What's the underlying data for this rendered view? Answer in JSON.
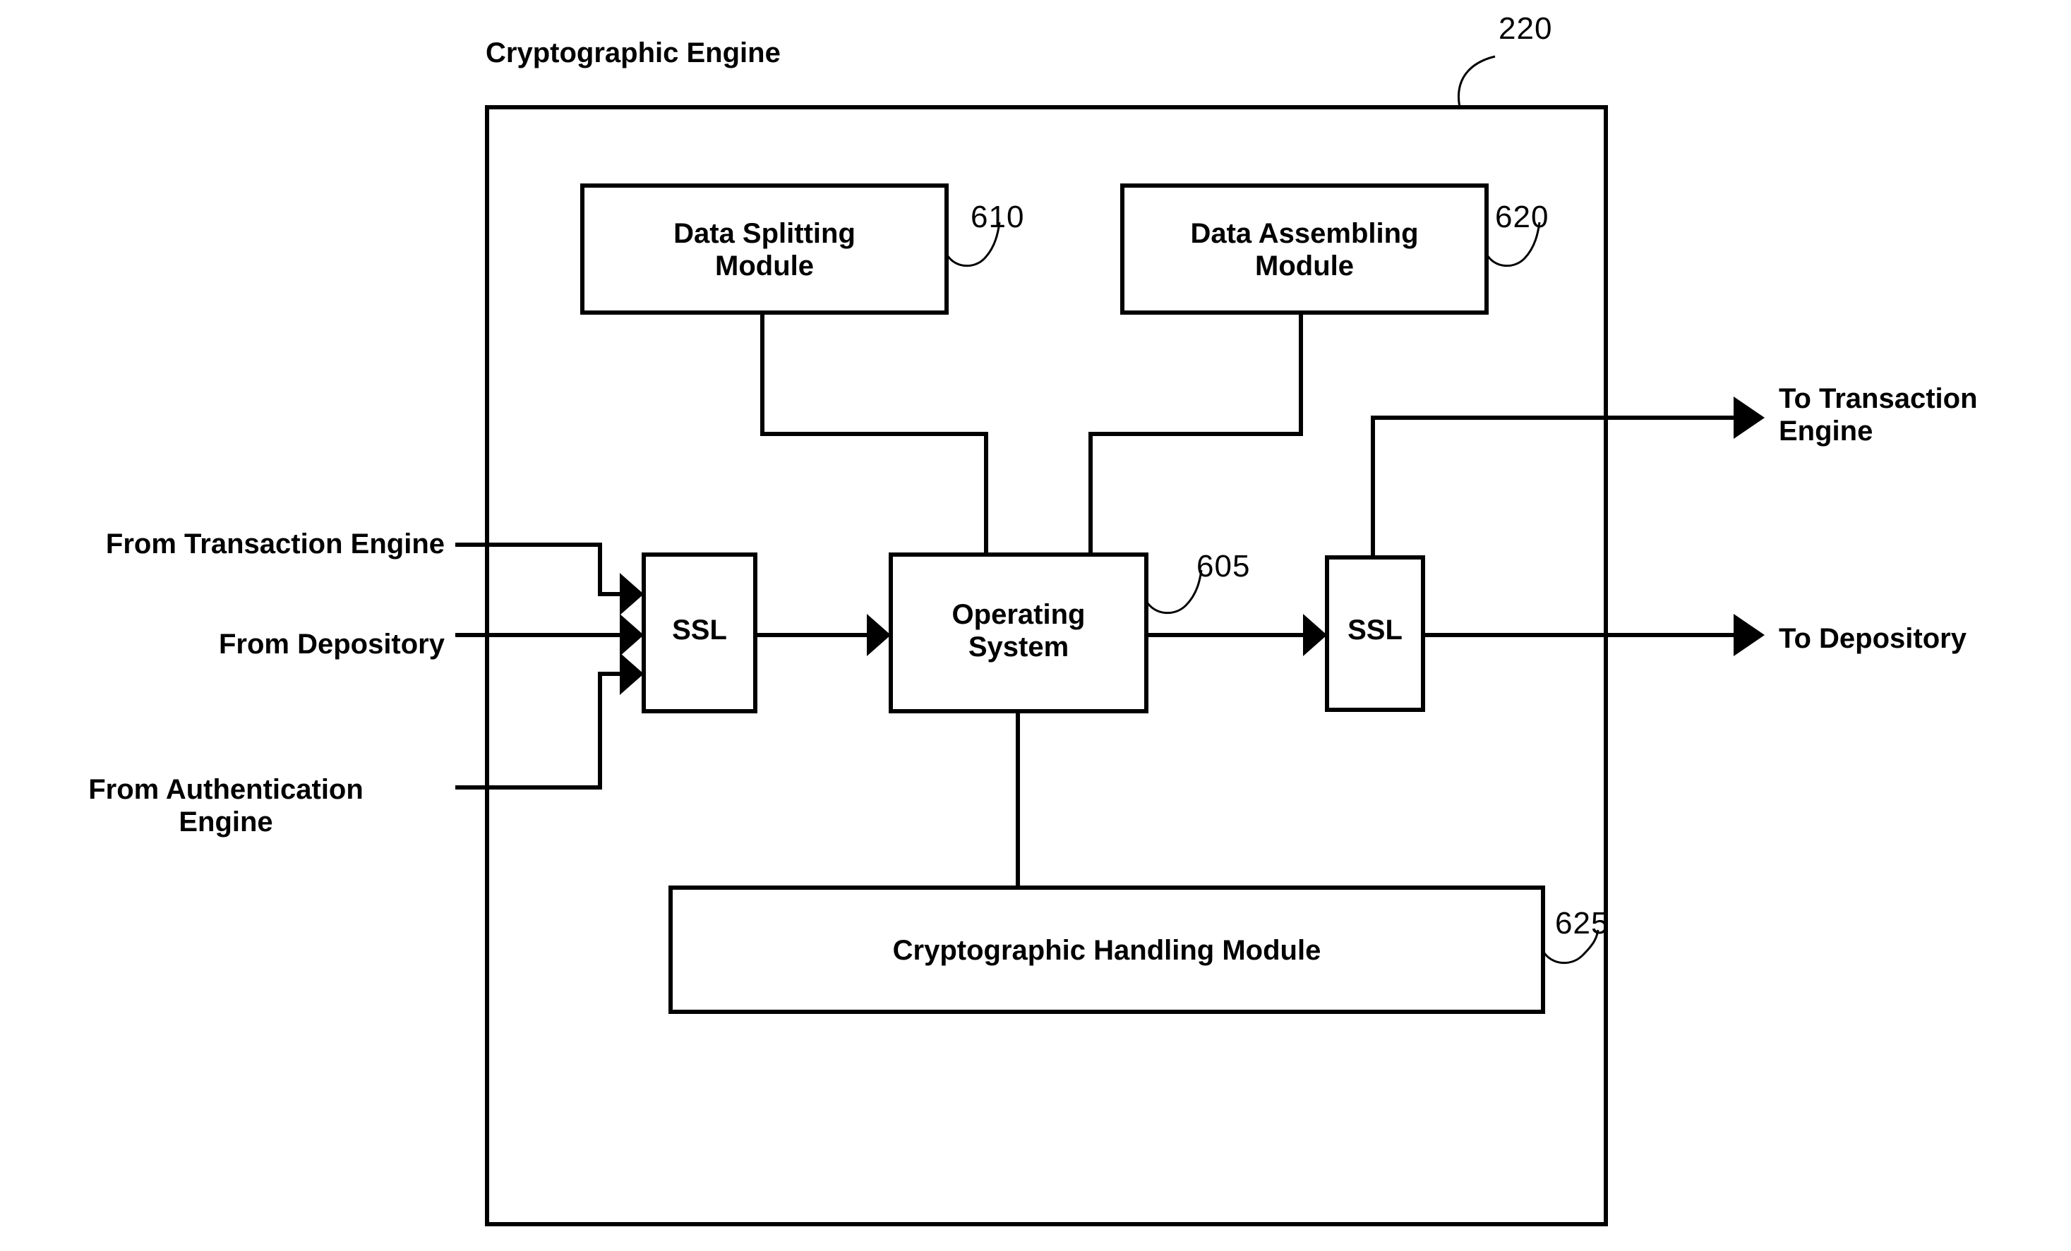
{
  "figure": {
    "title": "Cryptographic Engine",
    "container_ref": "220"
  },
  "blocks": [
    {
      "id": "data-splitting-module",
      "label": "Data Splitting\nModule",
      "ref": "610"
    },
    {
      "id": "data-assembling-module",
      "label": "Data Assembling\nModule",
      "ref": "620"
    },
    {
      "id": "ssl-inbound",
      "label": "SSL",
      "ref": ""
    },
    {
      "id": "operating-system",
      "label": "Operating\nSystem",
      "ref": "605"
    },
    {
      "id": "ssl-outbound",
      "label": "SSL",
      "ref": ""
    },
    {
      "id": "cryptographic-handling-module",
      "label": "Cryptographic Handling Module",
      "ref": "625"
    }
  ],
  "inputs": [
    {
      "id": "from-transaction-engine",
      "label": "From Transaction Engine"
    },
    {
      "id": "from-depository",
      "label": "From Depository"
    },
    {
      "id": "from-authentication-engine",
      "label": "From Authentication\nEngine"
    }
  ],
  "outputs": [
    {
      "id": "to-transaction-engine",
      "label": "To Transaction\nEngine"
    },
    {
      "id": "to-depository",
      "label": "To Depository"
    }
  ],
  "refs": {
    "container": "220",
    "data_splitting": "610",
    "data_assembling": "620",
    "operating_system": "605",
    "cryptographic_handling": "625"
  },
  "colors": {
    "stroke": "#000000",
    "background": "#ffffff",
    "text": "#000000"
  },
  "chart_data": {
    "type": "diagram",
    "title": "Cryptographic Engine",
    "nodes": [
      {
        "name": "Data Splitting Module",
        "ref": "610"
      },
      {
        "name": "Data Assembling Module",
        "ref": "620"
      },
      {
        "name": "SSL",
        "ref": ""
      },
      {
        "name": "Operating System",
        "ref": "605"
      },
      {
        "name": "SSL",
        "ref": ""
      },
      {
        "name": "Cryptographic Handling Module",
        "ref": "625"
      }
    ],
    "edges": [
      {
        "from": "From Transaction Engine",
        "to": "SSL (inbound)",
        "arrow": true
      },
      {
        "from": "From Depository",
        "to": "SSL (inbound)",
        "arrow": true
      },
      {
        "from": "From Authentication Engine",
        "to": "SSL (inbound)",
        "arrow": true
      },
      {
        "from": "SSL (inbound)",
        "to": "Operating System",
        "arrow": true
      },
      {
        "from": "Data Splitting Module",
        "to": "Operating System",
        "arrow": false
      },
      {
        "from": "Data Assembling Module",
        "to": "Operating System",
        "arrow": false
      },
      {
        "from": "Operating System",
        "to": "Cryptographic Handling Module",
        "arrow": false
      },
      {
        "from": "Operating System",
        "to": "SSL (outbound)",
        "arrow": true
      },
      {
        "from": "SSL (outbound)",
        "to": "To Transaction Engine",
        "arrow": true
      },
      {
        "from": "SSL (outbound)",
        "to": "To Depository",
        "arrow": true
      }
    ]
  }
}
